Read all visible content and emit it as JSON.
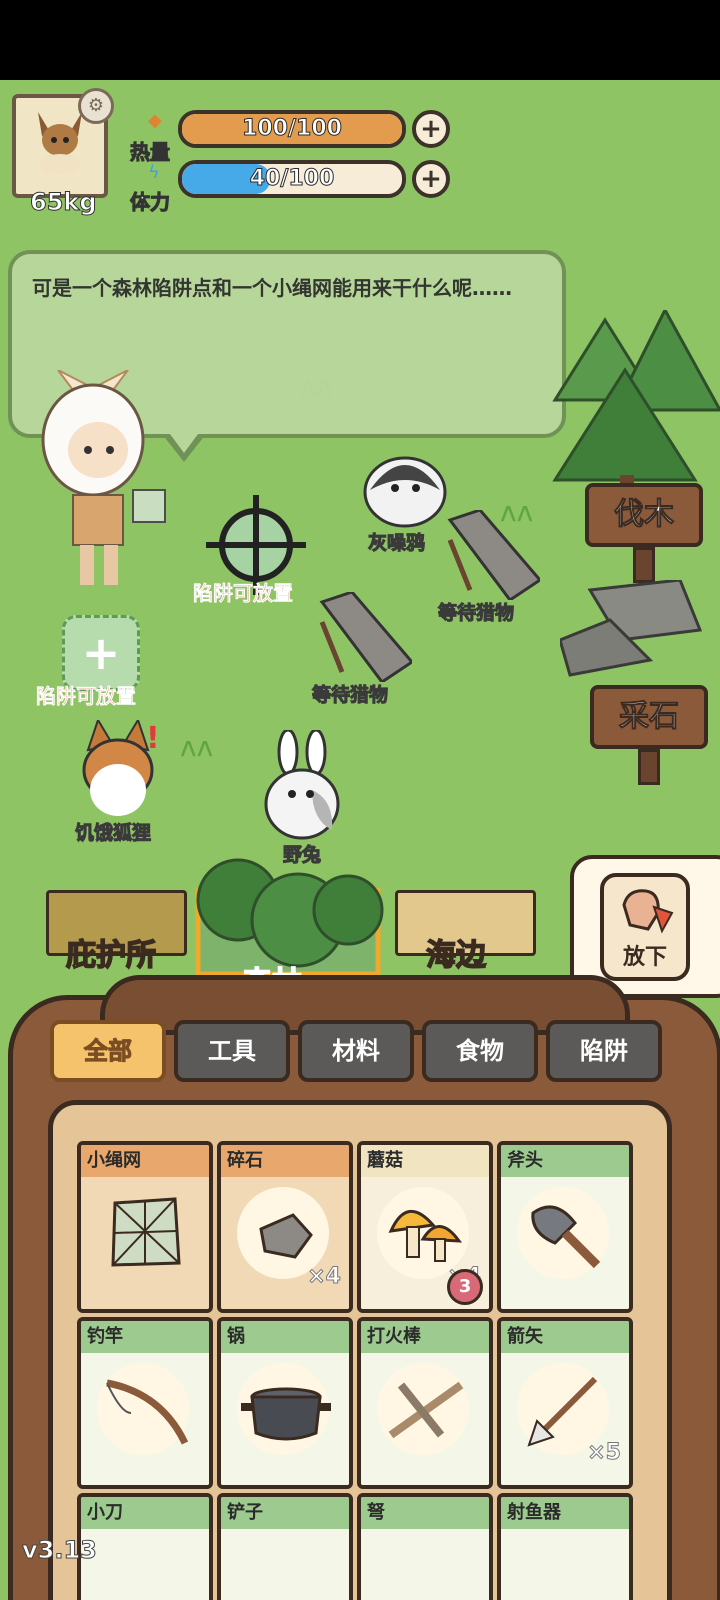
{
  "hud": {
    "weight": "65kg",
    "calories": {
      "label": "热量",
      "text": "100/100",
      "fill": 1.0
    },
    "stamina": {
      "label": "体力",
      "text": "40/100",
      "fill": 0.4
    }
  },
  "dialog": {
    "text": "可是一个森林陷阱点和一个小绳网能用来干什么呢……"
  },
  "map": {
    "creatures": {
      "crow": "灰噪鸦",
      "fox": "饥饿狐狸",
      "rabbit": "野兔"
    },
    "traps": {
      "waiting_1": "等待猎物",
      "waiting_2": "等待猎物",
      "placeable_1": "陷阱可放置",
      "placeable_2": "陷阱可放置"
    },
    "signs": {
      "wood": "伐木",
      "stone": "采石"
    }
  },
  "locations": {
    "shelter": "庇护所",
    "forest": "森林",
    "beach": "海边"
  },
  "drop_button": "放下",
  "categories": [
    "全部",
    "工具",
    "材料",
    "食物",
    "陷阱"
  ],
  "items": [
    {
      "name": "小绳网",
      "qty": "",
      "type": "orange"
    },
    {
      "name": "碎石",
      "qty": "×4",
      "type": "orange"
    },
    {
      "name": "蘑菇",
      "qty": "×4",
      "type": "plain",
      "badge": "3"
    },
    {
      "name": "斧头",
      "qty": "",
      "type": "green"
    },
    {
      "name": "钓竿",
      "qty": "",
      "type": "green"
    },
    {
      "name": "锅",
      "qty": "",
      "type": "green"
    },
    {
      "name": "打火棒",
      "qty": "",
      "type": "green"
    },
    {
      "name": "箭矢",
      "qty": "×5",
      "type": "green"
    },
    {
      "name": "小刀",
      "qty": "",
      "type": "green"
    },
    {
      "name": "铲子",
      "qty": "",
      "type": "green"
    },
    {
      "name": "弩",
      "qty": "",
      "type": "green"
    },
    {
      "name": "射鱼器",
      "qty": "",
      "type": "green"
    }
  ],
  "version": "v3.13"
}
